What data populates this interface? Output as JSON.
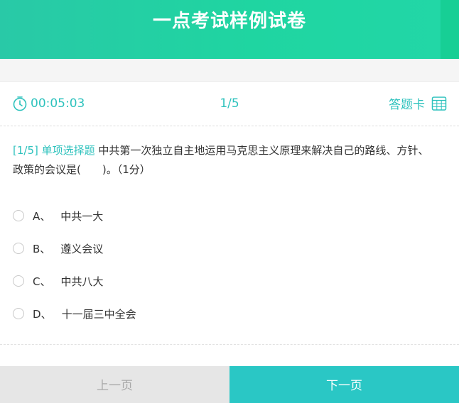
{
  "header": {
    "title": "一点考试样例试卷"
  },
  "info_bar": {
    "timer": "00:05:03",
    "progress": "1/5",
    "answer_card_label": "答题卡"
  },
  "question": {
    "tag": "[1/5] 单项选择题",
    "text": "中共第一次独立自主地运用马克思主义原理来解决自己的路线、方针、政策的会议是(　　)。（1分）"
  },
  "options": [
    {
      "letter": "A、",
      "text": "中共一大"
    },
    {
      "letter": "B、",
      "text": "遵义会议"
    },
    {
      "letter": "C、",
      "text": "中共八大"
    },
    {
      "letter": "D、",
      "text": "十一届三中全会"
    }
  ],
  "nav": {
    "prev_label": "上一页",
    "next_label": "下一页"
  },
  "colors": {
    "accent": "#2ec2bd",
    "header": "#1fd5a1",
    "next_button": "#2ac7c5",
    "prev_button": "#e6e6e6"
  },
  "icons": {
    "timer": "stopwatch-icon",
    "answer_card": "grid-card-icon"
  }
}
